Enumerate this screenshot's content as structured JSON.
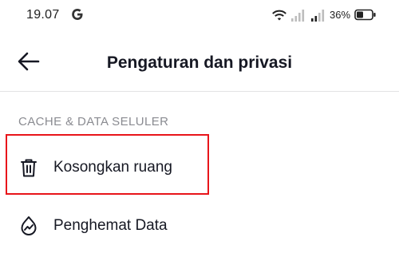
{
  "status_bar": {
    "time": "19.07",
    "notification_icon": "google-g-icon",
    "wifi_icon": "wifi-icon",
    "signal_icon": "signal-icon",
    "battery_percent": "36%",
    "battery_icon": "battery-icon"
  },
  "header": {
    "back_icon": "arrow-left-icon",
    "title": "Pengaturan dan privasi"
  },
  "section": {
    "header": "CACHE & DATA SELULER",
    "items": [
      {
        "label": "Kosongkan ruang",
        "icon": "trash-icon"
      },
      {
        "label": "Penghemat Data",
        "icon": "data-saver-icon"
      }
    ]
  },
  "colors": {
    "text_primary": "#161823",
    "text_secondary": "#8a8b91",
    "highlight": "#e8141a",
    "divider": "#e3e3e4"
  }
}
